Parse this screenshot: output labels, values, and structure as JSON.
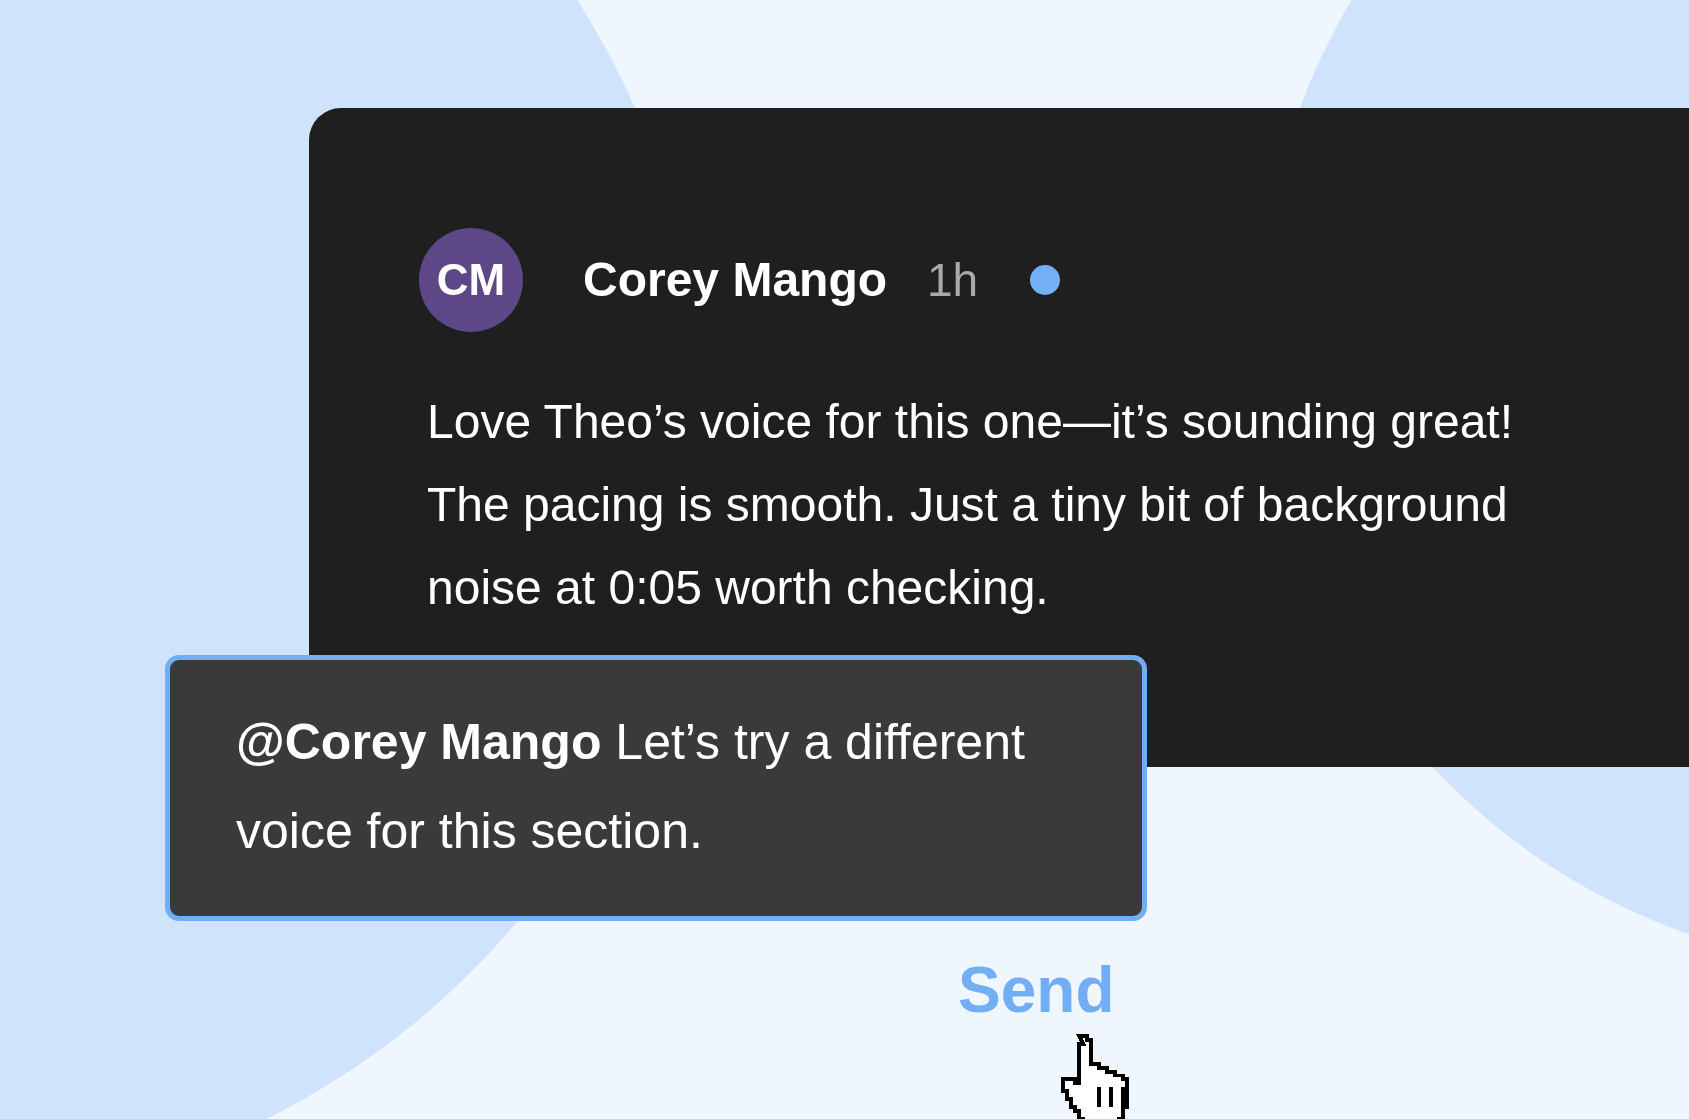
{
  "comment": {
    "avatar_initials": "CM",
    "author": "Corey Mango",
    "time": "1h",
    "unread": true,
    "body": "Love Theo’s voice for this one—it’s sounding great! The pacing is smooth. Just a tiny bit of background noise at 0:05 worth checking."
  },
  "reply": {
    "text": "**@Corey Mango** Let’s try a different voice for this section.",
    "focused": true
  },
  "send_button": {
    "label": "Send"
  }
}
